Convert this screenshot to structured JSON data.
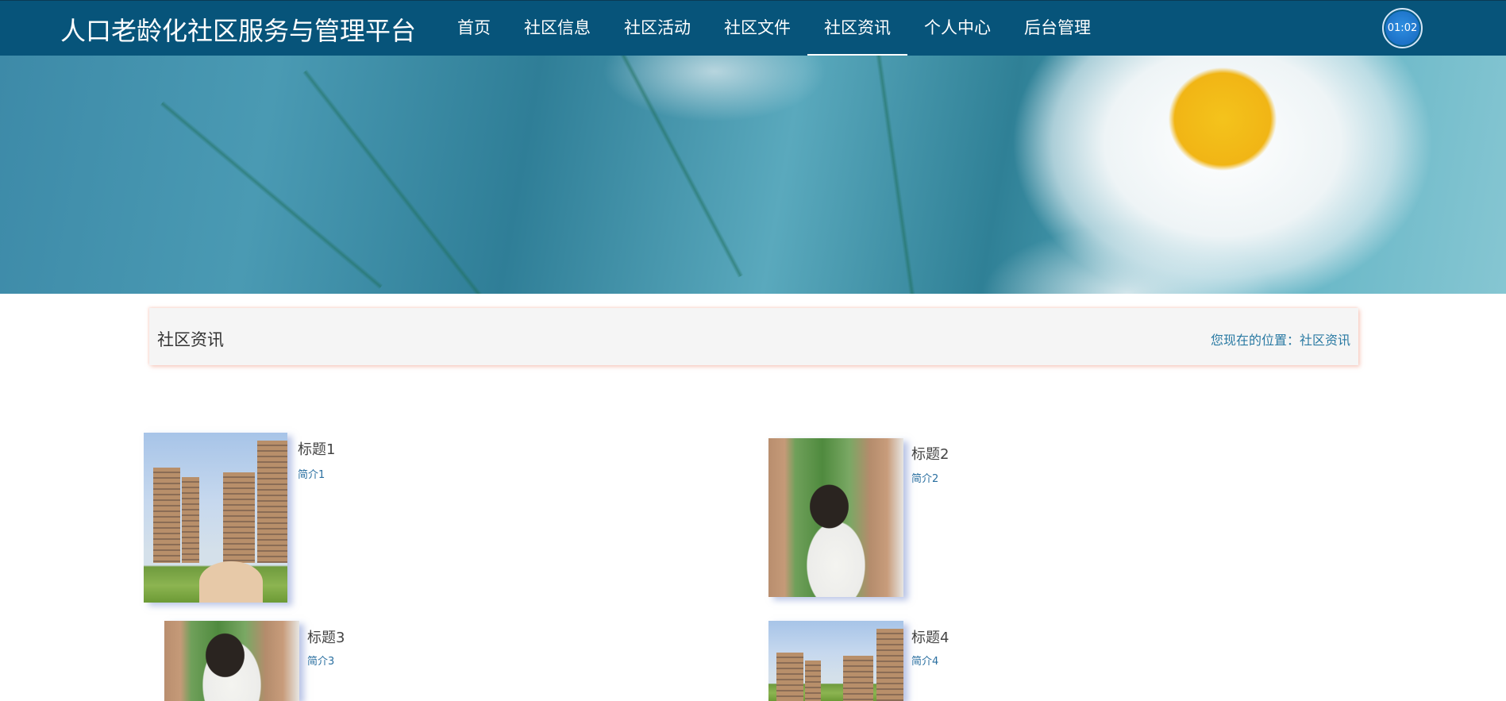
{
  "header": {
    "site_title": "人口老龄化社区服务与管理平台",
    "nav": [
      {
        "label": "首页",
        "active": false
      },
      {
        "label": "社区信息",
        "active": false
      },
      {
        "label": "社区活动",
        "active": false
      },
      {
        "label": "社区文件",
        "active": false
      },
      {
        "label": "社区资讯",
        "active": true
      },
      {
        "label": "个人中心",
        "active": false
      },
      {
        "label": "后台管理",
        "active": false
      }
    ],
    "clock": "01:02"
  },
  "banner": {
    "slide_count": 3,
    "active_slide": 1
  },
  "section": {
    "title": "社区资讯",
    "breadcrumb": "您现在的位置：社区资讯"
  },
  "news": [
    {
      "title": "标题1",
      "intro": "简介1",
      "image": "buildings"
    },
    {
      "title": "标题2",
      "intro": "简介2",
      "image": "people"
    },
    {
      "title": "标题3",
      "intro": "简介3",
      "image": "people"
    },
    {
      "title": "标题4",
      "intro": "简介4",
      "image": "buildings"
    }
  ],
  "colors": {
    "header_bg": "#07547a",
    "breadcrumb": "#2a7aa3",
    "section_bg": "#f5f5f5"
  }
}
